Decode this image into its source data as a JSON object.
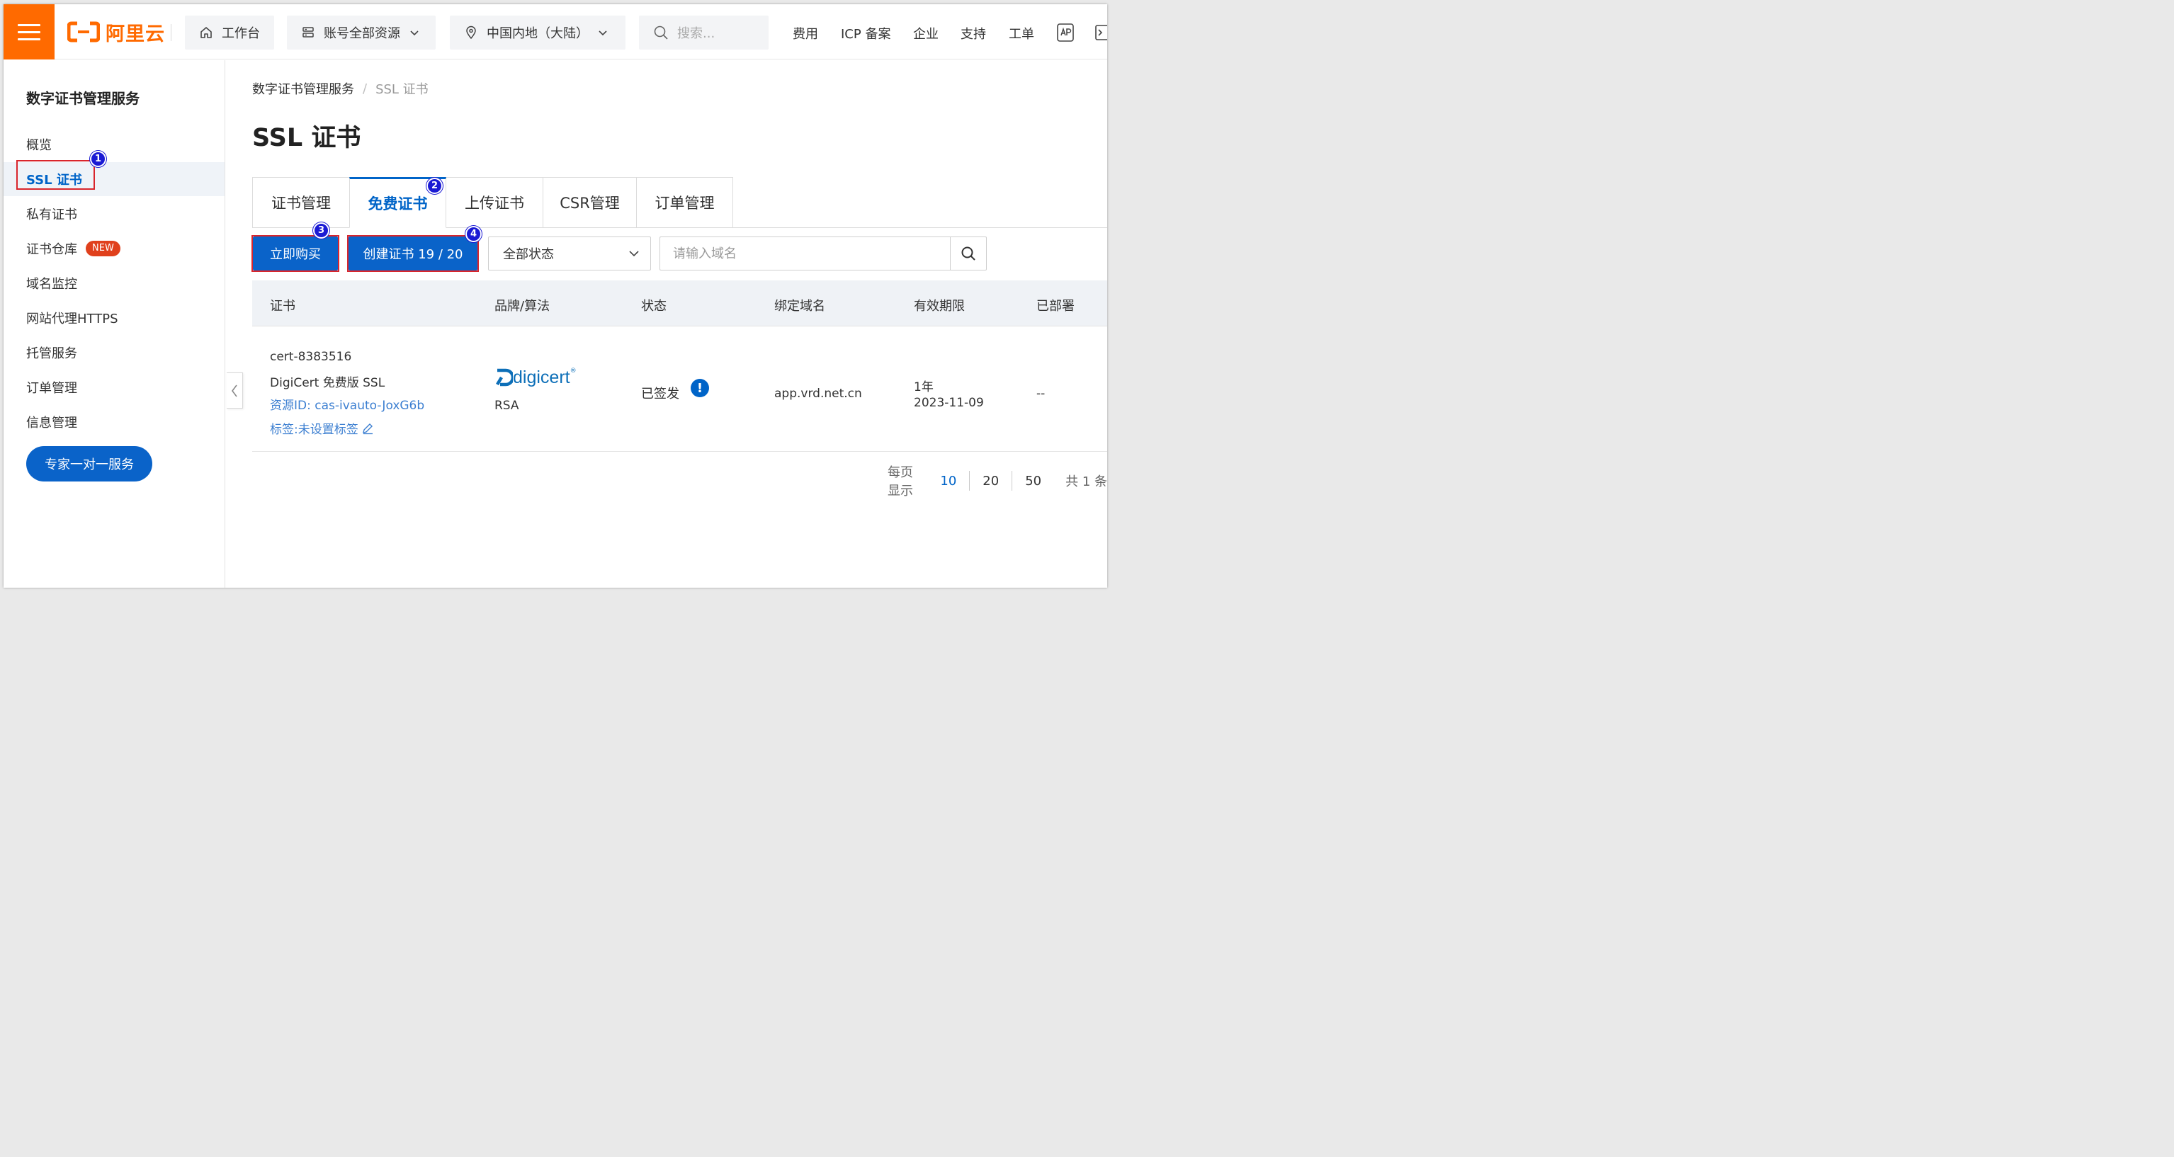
{
  "header": {
    "logo_text": "阿里云",
    "workbench": "工作台",
    "resources": "账号全部资源",
    "region": "中国内地（大陆）",
    "search_placeholder": "搜索...",
    "nav": [
      "费用",
      "ICP 备案",
      "企业",
      "支持",
      "工单"
    ]
  },
  "sidebar": {
    "title": "数字证书管理服务",
    "items": [
      {
        "label": "概览"
      },
      {
        "label": "SSL 证书"
      },
      {
        "label": "私有证书"
      },
      {
        "label": "证书仓库",
        "badge": "NEW"
      },
      {
        "label": "域名监控"
      },
      {
        "label": "网站代理HTTPS"
      },
      {
        "label": "托管服务"
      },
      {
        "label": "订单管理"
      },
      {
        "label": "信息管理"
      }
    ],
    "expert_button": "专家一对一服务"
  },
  "breadcrumb": {
    "root": "数字证书管理服务",
    "sep": "/",
    "current": "SSL 证书"
  },
  "page_title": "SSL 证书",
  "tabs": [
    "证书管理",
    "免费证书",
    "上传证书",
    "CSR管理",
    "订单管理"
  ],
  "toolbar": {
    "buy_button": "立即购买",
    "create_button": "创建证书 19 / 20",
    "status_select": "全部状态",
    "domain_placeholder": "请输入域名"
  },
  "table": {
    "headers": [
      "证书",
      "品牌/算法",
      "状态",
      "绑定域名",
      "有效期限",
      "已部署"
    ],
    "rows": [
      {
        "cert_id": "cert-8383516",
        "cert_name": "DigiCert 免费版 SSL",
        "resource_id": "资源ID: cas-ivauto-JoxG6b",
        "tags": "标签:未设置标签",
        "brand_logo": "digicert",
        "brand_trademark": "®",
        "algorithm": "RSA",
        "status": "已签发",
        "status_icon": "!",
        "domain": "app.vrd.net.cn",
        "validity": "1年",
        "expiry": "2023-11-09",
        "deployed": "--"
      }
    ]
  },
  "pagination": {
    "label": "每页显示",
    "sizes": [
      "10",
      "20",
      "50"
    ],
    "total": "共 1 条"
  },
  "annotations": [
    "1",
    "2",
    "3",
    "4"
  ],
  "colors": {
    "brand_orange": "#ff6a00",
    "primary_blue": "#0a63c9",
    "highlight_red": "#d9252c",
    "marker_blue": "#1a1ad4"
  }
}
